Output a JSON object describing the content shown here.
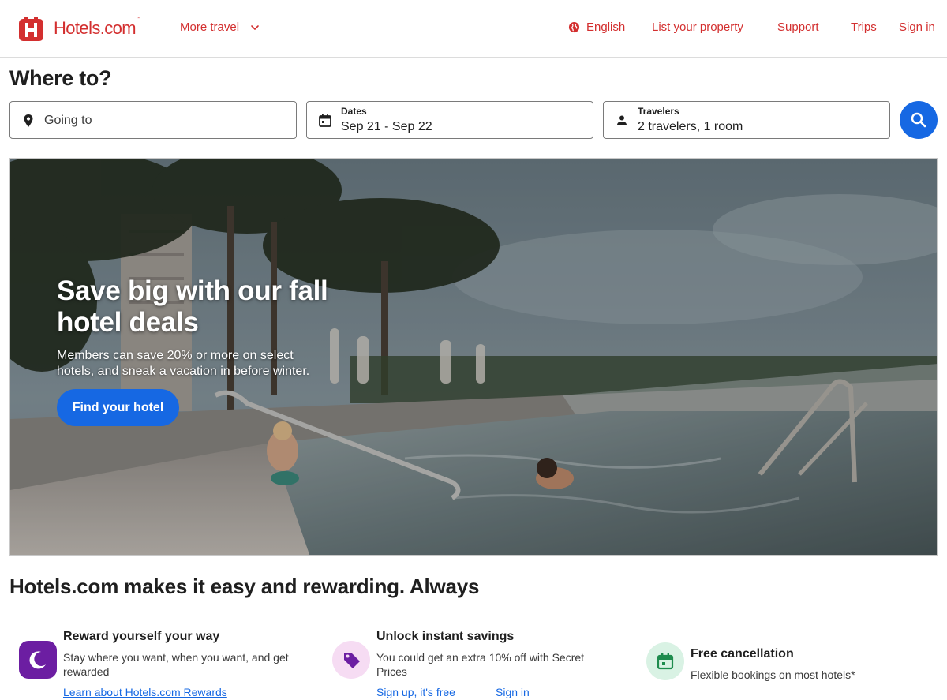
{
  "brand": {
    "name": "Hotels.com",
    "trademark": "™",
    "accent_color": "#d32f2f",
    "primary_button_color": "#1668e3"
  },
  "header": {
    "more_travel": "More travel",
    "language": "English",
    "list_property": "List your property",
    "support": "Support",
    "trips": "Trips",
    "sign_in": "Sign in"
  },
  "search": {
    "title": "Where to?",
    "destination": {
      "placeholder": "Going to",
      "icon": "map-pin-icon"
    },
    "dates": {
      "label": "Dates",
      "value": "Sep 21 - Sep 22",
      "icon": "calendar-icon"
    },
    "travelers": {
      "label": "Travelers",
      "value": "2 travelers, 1 room",
      "icon": "person-icon"
    },
    "button_icon": "search-icon"
  },
  "hero": {
    "title": "Save big with our fall hotel deals",
    "subtitle": "Members can save 20% or more on select hotels, and sneak a vacation in before winter.",
    "button": "Find your hotel"
  },
  "rewarding": {
    "title": "Hotels.com makes it easy and rewarding. Always",
    "features": [
      {
        "icon": "moon-icon",
        "title": "Reward yourself your way",
        "description": "Stay where you want, when you want, and get rewarded",
        "links": [
          "Learn about Hotels.com Rewards"
        ]
      },
      {
        "icon": "tag-icon",
        "title": "Unlock instant savings",
        "description": "You could get an extra 10% off with Secret Prices",
        "links": [
          "Sign up, it's free",
          "Sign in"
        ]
      },
      {
        "icon": "calendar-check-icon",
        "title": "Free cancellation",
        "description": "Flexible bookings on most hotels*",
        "links": []
      }
    ]
  }
}
